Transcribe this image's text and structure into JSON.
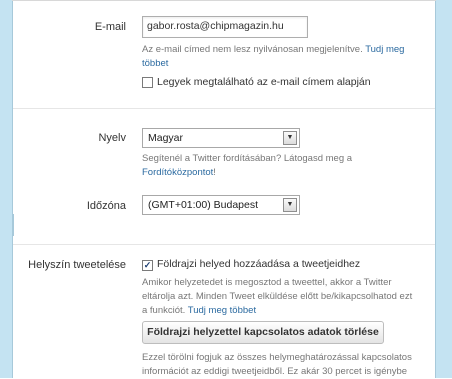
{
  "email_section": {
    "label": "E-mail",
    "value": "gabor.rosta@chipmagazin.hu",
    "help_text": "Az e-mail címed nem lesz nyilvánosan megjelenítve.",
    "help_link": "Tudj meg",
    "help_link_2": "többet",
    "discoverable_checkbox_label": "Legyek megtalálható az e-mail címem alapján",
    "discoverable_checked": false
  },
  "language_section": {
    "label": "Nyelv",
    "selected": "Magyar",
    "help_text": "Segítenél a Twitter fordításában? Látogasd meg a",
    "help_link": "Fordítóközpontot",
    "help_suffix": "!"
  },
  "timezone_section": {
    "label": "Időzóna",
    "selected": "(GMT+01:00) Budapest"
  },
  "location_section": {
    "label": "Helyszín tweetelése",
    "checkbox_label": "Földrajzi helyed hozzáadása a tweetjeidhez",
    "checked": true,
    "help_line_1": "Amikor helyzetedet is megosztod a tweettel, akkor a Twitter",
    "help_line_2": "eltárolja azt. Minden Tweet elküldése előtt be/kikapcsolhatod ezt",
    "help_line_3": "a funkciót.",
    "help_link": "Tudj meg többet",
    "delete_button": "Földrajzi helyzettel kapcsolatos adatok törlése",
    "footer_line_1": "Ezzel törölni fogjuk az összes helymeghatározással kapcsolatos",
    "footer_line_2": "információt az eddigi tweetjeidből. Ez akár 30 percet is igénybe"
  },
  "icons": {
    "checkmark": "✓",
    "dropdown": "▼"
  },
  "colors": {
    "link": "#2b6aa0",
    "sidebar": "#c4e3f2"
  }
}
